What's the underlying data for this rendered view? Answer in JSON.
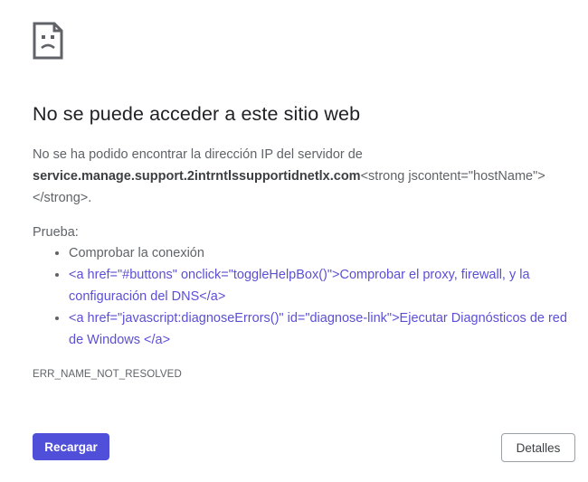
{
  "error_page": {
    "title": "No se puede acceder a este sitio web",
    "message_intro": "No se ha podido encontrar la dirección IP del servidor de",
    "host_name": "service.manage.support.2intrntlssupportidnetlx.com",
    "host_suffix_raw": "<strong jscontent=\"hostName\"></strong>.",
    "try_label": "Prueba:",
    "suggestions": [
      {
        "text": "Comprobar la conexión",
        "is_link": false
      },
      {
        "text": "<a href=\"#buttons\" onclick=\"toggleHelpBox()\">Comprobar el proxy, firewall, y la configuración del DNS</a>",
        "is_link": true
      },
      {
        "text": "<a href=\"javascript:diagnoseErrors()\" id=\"diagnose-link\">Ejecutar Diagnósticos de red de Windows </a>",
        "is_link": true
      }
    ],
    "error_code": "ERR_NAME_NOT_RESOLVED",
    "reload_label": "Recargar",
    "details_label": "Detalles"
  },
  "colors": {
    "primary_button": "#4f4fd9",
    "link": "#5b4fd6",
    "text_secondary": "#5f6368",
    "title": "#202124"
  },
  "icons": {
    "sad_page": "sad-page-icon"
  }
}
